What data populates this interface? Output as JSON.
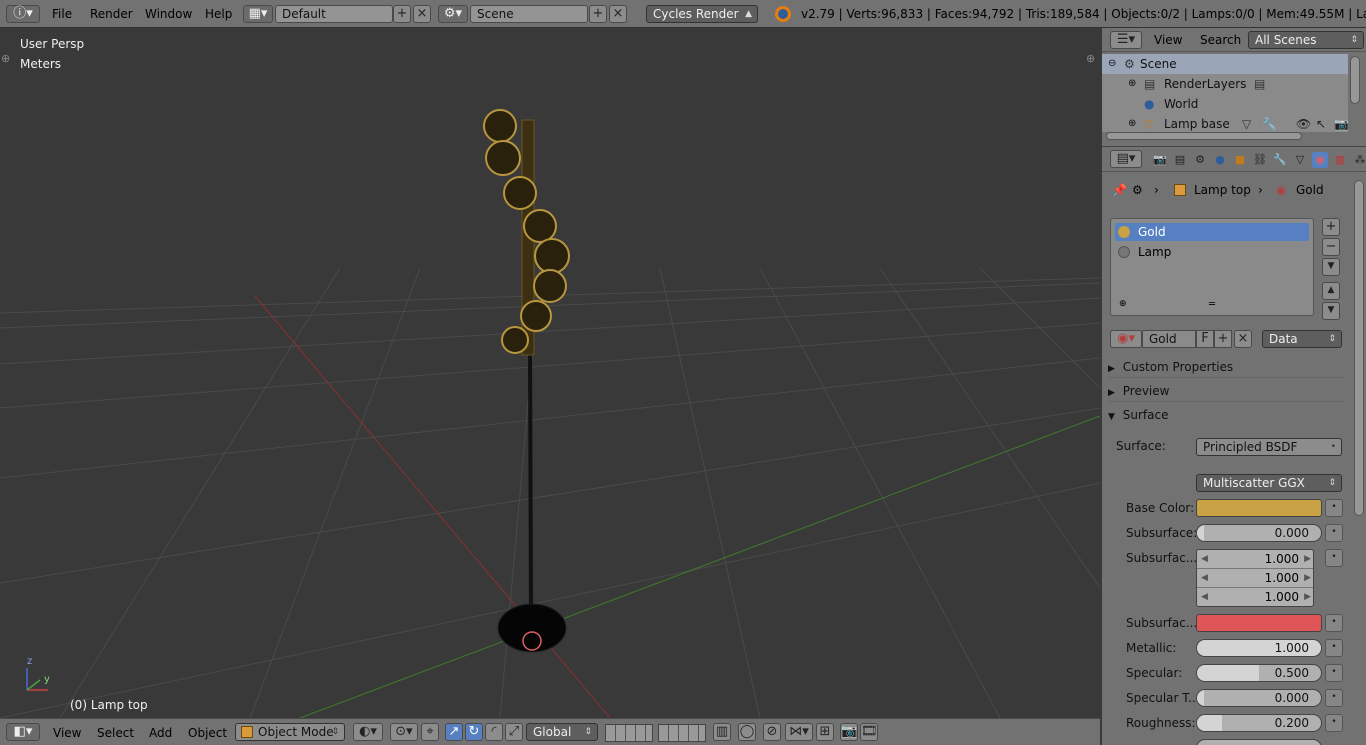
{
  "topbar": {
    "menu": [
      "File",
      "Render",
      "Window",
      "Help"
    ],
    "layout_name": "Default",
    "scene_name": "Scene",
    "render_engine": "Cycles Render",
    "stats": "v2.79 | Verts:96,833 | Faces:94,792 | Tris:189,584 | Objects:0/2 | Lamps:0/0 | Mem:49.55M | Lamp top"
  },
  "viewport": {
    "view_name": "User Persp",
    "units": "Meters",
    "object_label": "(0) Lamp top",
    "axis_z": "z",
    "axis_y": "y"
  },
  "viewport_toolbar": {
    "menu": [
      "View",
      "Select",
      "Add",
      "Object"
    ],
    "mode": "Object Mode",
    "orientation": "Global"
  },
  "outliner": {
    "header_menu": [
      "View",
      "Search"
    ],
    "filter": "All Scenes",
    "items": [
      {
        "label": "Scene",
        "selected": true
      },
      {
        "label": "RenderLayers"
      },
      {
        "label": "World"
      },
      {
        "label": "Lamp base"
      }
    ]
  },
  "properties": {
    "breadcrumb": {
      "object": "Lamp top",
      "material": "Gold"
    },
    "material_slots": [
      {
        "label": "Gold",
        "selected": true
      },
      {
        "label": "Lamp"
      }
    ],
    "material_name": "Gold",
    "fake_user_label": "F",
    "link_mode": "Data",
    "panels": {
      "custom_properties": "Custom Properties",
      "preview": "Preview",
      "surface": "Surface"
    },
    "surface_label": "Surface:",
    "surface_shader": "Principled BSDF",
    "distribution": "Multiscatter GGX",
    "fields": {
      "base_color_label": "Base Color:",
      "base_color": "#c8a244",
      "subsurface_label": "Subsurface:",
      "subsurface_value": "0.000",
      "subsurface_radius_label": "Subsurfac...",
      "subsurface_radius": [
        "1.000",
        "1.000",
        "1.000"
      ],
      "subsurface_color_label": "Subsurfac...",
      "subsurface_color": "#e05656",
      "metallic_label": "Metallic:",
      "metallic_value": "1.000",
      "metallic_fraction": 1.0,
      "specular_label": "Specular:",
      "specular_value": "0.500",
      "specular_fraction": 0.5,
      "specular_tint_label": "Specular T...",
      "specular_tint_value": "0.000",
      "roughness_label": "Roughness:",
      "roughness_value": "0.200",
      "roughness_fraction": 0.2
    }
  },
  "colors": {
    "selection": "#5680c2",
    "gold": "#c8a244",
    "ui_gray": "#727272",
    "viewport_bg": "#393939"
  }
}
